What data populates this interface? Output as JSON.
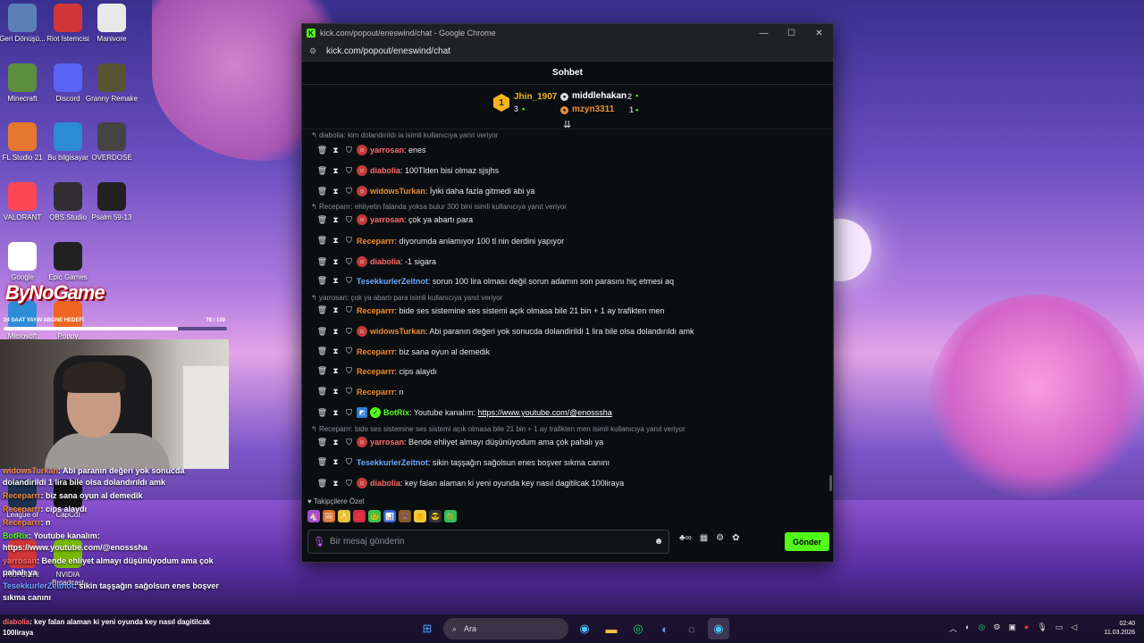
{
  "desktop": {
    "icons": [
      {
        "label": "Geri\nDönüşü...",
        "icon": "recycle-bin-icon"
      },
      {
        "label": "Riot İstemcisi",
        "icon": "riot-client-icon"
      },
      {
        "label": "Manivore",
        "icon": "manivore-icon"
      },
      {
        "label": "Minecraft",
        "icon": "minecraft-icon"
      },
      {
        "label": "Discord",
        "icon": "discord-icon"
      },
      {
        "label": "Granny Remake",
        "icon": "granny-icon"
      },
      {
        "label": "FL Studio 21",
        "icon": "fl-studio-icon"
      },
      {
        "label": "Bu bilgisayar",
        "icon": "this-pc-icon"
      },
      {
        "label": "OVERDOSE",
        "icon": "overdose-icon"
      },
      {
        "label": "VALORANT",
        "icon": "valorant-icon"
      },
      {
        "label": "OBS Studio",
        "icon": "obs-icon"
      },
      {
        "label": "Psalm 59-13",
        "icon": "psalm-icon"
      },
      {
        "label": "Google",
        "icon": "chrome-icon"
      },
      {
        "label": "Epic Games",
        "icon": "epic-games-icon"
      },
      {
        "label": "Microsoft",
        "icon": "edge-icon"
      },
      {
        "label": "Poppy",
        "icon": "poppy-icon"
      },
      {
        "label": "League of",
        "icon": "league-icon"
      },
      {
        "label": "CapCut",
        "icon": "capcut-icon"
      },
      {
        "label": "Riot Client",
        "icon": "riot-client-icon"
      },
      {
        "label": "NVIDIA Broadcast",
        "icon": "nvidia-icon"
      }
    ]
  },
  "overlay": {
    "logo_text": "ByNoGame",
    "sub_goal_label": "24 SAAT YAYIN ABONE HEDEFİ",
    "sub_goal_count": "78 / 100",
    "sub_goal_progress": 0.78,
    "chat": [
      {
        "user": "widowsTurkan",
        "text": ": Abi paranın değeri yok sonucda dolandirildi 1 lira bile olsa dolandırıldı amk",
        "color": "#e88d3a"
      },
      {
        "user": "Receparrr",
        "text": ": biz sana oyun al demedik",
        "color": "#f28c28"
      },
      {
        "user": "Receparrr",
        "text": ": cips alaydı",
        "color": "#f28c28"
      },
      {
        "user": "Receparrr",
        "text": ": n",
        "color": "#f28c28"
      },
      {
        "user": "BotRix",
        "text": ": Youtube kanalım: https://www.youtube.com/@enosssha",
        "color": "#53fc18"
      },
      {
        "user": "yarrosan",
        "text": ": Bende ehliyet almayı düşünüyodum ama çok pahalı ya",
        "color": "#ff6b6b"
      },
      {
        "user": "TesekkurlerZeitnot",
        "text": ": sikin taşşağın sağolsun enes boşver sıkma canını",
        "color": "#6ba8ff"
      }
    ]
  },
  "window": {
    "title": "kick.com/popout/eneswind/chat - Google Chrome",
    "url": "kick.com/popout/eneswind/chat",
    "favicon_letter": "K",
    "controls": [
      "—",
      "☐",
      "✕"
    ],
    "accent": "#53fc18"
  },
  "chat": {
    "header": "Sohbet",
    "top_gifters": [
      {
        "rank": "1",
        "name": "Jhin_1907",
        "count": "3",
        "color": "#f2b31f"
      },
      {
        "name": "middlehakan",
        "count": "2",
        "color": "#ffffff"
      },
      {
        "name": "mzyn3311",
        "count": "1",
        "color": "#e88d3a"
      }
    ],
    "messages": [
      {
        "kind": "reply",
        "text": "diabolia: kim dolandırıldı ia isimli kullanıcıya yanıt veriyor"
      },
      {
        "kind": "msg",
        "user": "yarrosan",
        "color": "#ff6b6b",
        "badge": "avatar",
        "text": ": enes"
      },
      {
        "kind": "msg",
        "user": "diabolia",
        "color": "#ff6b6b",
        "badge": "avatar",
        "text": ": 100Tlden bisi olmaz sjsjhs"
      },
      {
        "kind": "msg",
        "user": "widowsTurkan",
        "color": "#e88d3a",
        "badge": "avatar",
        "text": ": İyiki daha fazla gitmedi abi ya"
      },
      {
        "kind": "reply",
        "text": "Receparrr: ehliyetin falanda yoksa bulur 300 bini isimli kullanıcıya yanıt veriyor"
      },
      {
        "kind": "msg",
        "user": "yarrosan",
        "color": "#ff6b6b",
        "badge": "avatar",
        "text": ": çok ya abartı para"
      },
      {
        "kind": "msg",
        "user": "Receparrr",
        "color": "#f28c28",
        "badge": "none",
        "text": ": diyorumda anlamıyor 100 tl nin derdini yapıyor"
      },
      {
        "kind": "msg",
        "user": "diabolia",
        "color": "#ff6b6b",
        "badge": "avatar",
        "text": ": -1 sigara"
      },
      {
        "kind": "msg",
        "user": "TesekkurlerZeitnot",
        "color": "#6ba8ff",
        "badge": "none",
        "text": ": sorun 100 lira olması değil sorun adamın son parasını hiç etmesi aq"
      },
      {
        "kind": "reply",
        "text": "yarrosan: çok ya abartı para isimli kullanıcıya yanıt veriyor"
      },
      {
        "kind": "msg",
        "user": "Receparrr",
        "color": "#f28c28",
        "badge": "none",
        "text": ": bide ses sistemine ses sistemi açık olmasa bile 21 bin + 1 ay trafikten men"
      },
      {
        "kind": "msg",
        "user": "widowsTurkan",
        "color": "#e88d3a",
        "badge": "avatar",
        "text": ": Abi paranın değeri yok sonucda dolandirildi 1 lira bile olsa dolandırıldı amk"
      },
      {
        "kind": "msg",
        "user": "Receparrr",
        "color": "#f28c28",
        "badge": "none",
        "text": ": biz sana oyun al demedik"
      },
      {
        "kind": "msg",
        "user": "Receparrr",
        "color": "#f28c28",
        "badge": "none",
        "text": ": cips alaydı"
      },
      {
        "kind": "msg",
        "user": "Receparrr",
        "color": "#f28c28",
        "badge": "none",
        "text": ": n"
      },
      {
        "kind": "msg",
        "user": "BotRix",
        "color": "#53fc18",
        "badge": "bot",
        "text": ": Youtube kanalım: ",
        "link": "https://www.youtube.com/@enosssha"
      },
      {
        "kind": "reply",
        "text": "Receparrr: bide ses sistemine ses sistemi açık olmasa bile 21 bin + 1 ay trafikten men isimli kullanıcıya yanıt veriyor"
      },
      {
        "kind": "msg",
        "user": "yarrosan",
        "color": "#ff6b6b",
        "badge": "avatar",
        "text": ": Bende ehliyet almayı düşünüyodum ama çok pahalı ya"
      },
      {
        "kind": "msg",
        "user": "TesekkurlerZeitnot",
        "color": "#6ba8ff",
        "badge": "none",
        "text": ": sikin taşşağın sağolsun enes boşver sıkma canını"
      },
      {
        "kind": "msg",
        "user": "diabolia",
        "color": "#ff6b6b",
        "badge": "avatar",
        "text": ": key falan alaman ki yeni oyunda key nasıl dagitilcak 100liraya"
      }
    ],
    "emote_section_label": "Takipçilere Özel",
    "emotes": [
      "🦄",
      "🖼",
      "🍌",
      "💋",
      "🐸",
      "📊",
      "🐻",
      "🐥",
      "😎",
      "🟢"
    ],
    "input_placeholder": "Bir mesaj gönderin",
    "send_label": "Gönder"
  },
  "taskbar": {
    "message_user": "diabolia",
    "message_text": ": key falan alaman ki yeni oyunda key nasıl dagitilcak 100liraya",
    "search_label": "Ara",
    "time": "02:40",
    "date": "11.03.2026"
  }
}
